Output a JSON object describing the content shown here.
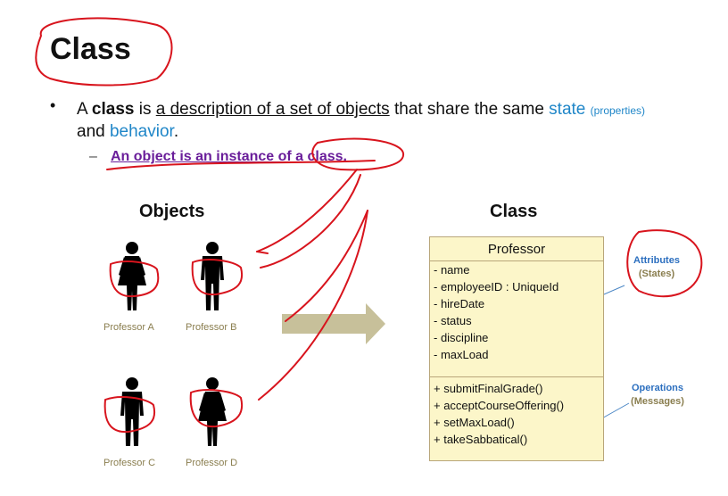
{
  "slide": {
    "title": "Class",
    "bullet": {
      "p1": "A ",
      "class_word": "class",
      "p2": " is ",
      "description": "a description of a set of objects",
      "p3": " that share the same ",
      "state": "state",
      "properties": "(properties)",
      "line2_p1": "and ",
      "behavior": "behavior",
      "line2_p2": "."
    },
    "sub_dash": "–",
    "sub_bullet": "An object is an instance of a class."
  },
  "objects": {
    "header": "Objects",
    "professors": [
      {
        "label": "Professor A",
        "gender": "female"
      },
      {
        "label": "Professor B",
        "gender": "male"
      },
      {
        "label": "Professor C",
        "gender": "male"
      },
      {
        "label": "Professor D",
        "gender": "female"
      }
    ]
  },
  "class_diagram": {
    "header": "Class",
    "name": "Professor",
    "attributes": [
      "- name",
      "- employeeID : UniqueId",
      "- hireDate",
      "- status",
      "- discipline",
      "- maxLoad"
    ],
    "operations": [
      "+ submitFinalGrade()",
      "+ acceptCourseOffering()",
      "+ setMaxLoad()",
      "+ takeSabbatical()"
    ]
  },
  "annotations": {
    "attributes_label": "Attributes",
    "attributes_sub": "(States)",
    "operations_label": "Operations",
    "operations_sub": "(Messages)"
  },
  "colors": {
    "accent_blue": "#1f86c8",
    "sub_bullet_purple": "#6a1e9a",
    "ink_red": "#d8141d",
    "uml_fill": "#fcf6c9",
    "uml_border": "#b9a67a",
    "arrow_fill": "#c7c09a",
    "label_olive": "#8a7e4f"
  },
  "icons": [
    "female-person-icon",
    "male-person-icon",
    "block-arrow-icon"
  ]
}
